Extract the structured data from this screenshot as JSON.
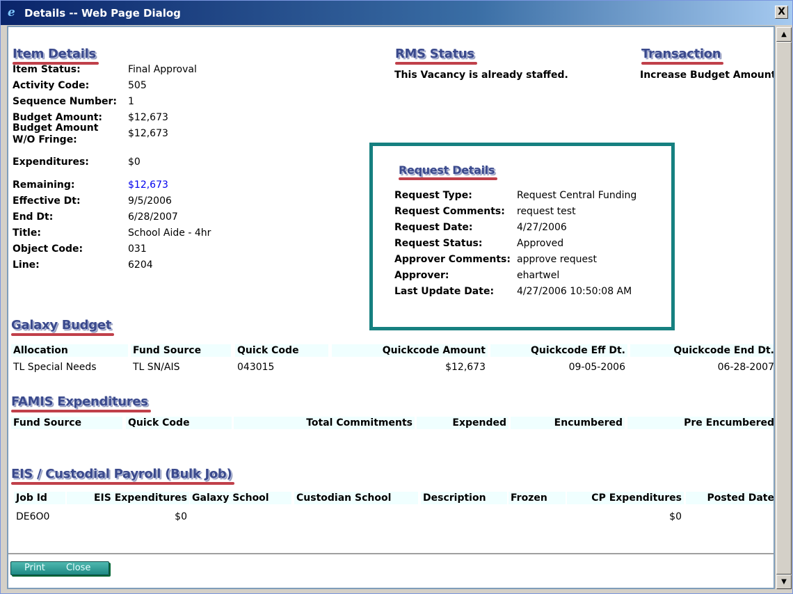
{
  "window": {
    "title": "Details -- Web Page Dialog",
    "close_glyph": "X",
    "icon": "ie-icon"
  },
  "item_details": {
    "heading": "Item Details",
    "rows": [
      {
        "label": "Item Status:",
        "value": "Final Approval"
      },
      {
        "label": "Activity Code:",
        "value": "505"
      },
      {
        "label": "Sequence Number:",
        "value": "1"
      },
      {
        "label": "Budget Amount:",
        "value": "$12,673"
      },
      {
        "label": "Budget Amount W/O Fringe:",
        "value": "$12,673"
      },
      {
        "label": "Expenditures:",
        "value": "$0"
      },
      {
        "label": "Remaining:",
        "value": "$12,673"
      },
      {
        "label": "Effective Dt:",
        "value": "9/5/2006"
      },
      {
        "label": "End Dt:",
        "value": "6/28/2007"
      },
      {
        "label": "Title:",
        "value": "School Aide - 4hr"
      },
      {
        "label": "Object Code:",
        "value": "031"
      },
      {
        "label": "Line:",
        "value": "6204"
      }
    ]
  },
  "rms_status": {
    "heading": "RMS Status",
    "text": "This Vacancy is already staffed."
  },
  "transaction": {
    "heading": "Transaction",
    "text": "Increase Budget Amount"
  },
  "request_details": {
    "heading": "Request Details",
    "rows": [
      {
        "label": "Request Type:",
        "value": "Request Central Funding"
      },
      {
        "label": "Request Comments:",
        "value": "request test"
      },
      {
        "label": "Request Date:",
        "value": "4/27/2006"
      },
      {
        "label": "Request Status:",
        "value": "Approved"
      },
      {
        "label": "Approver Comments:",
        "value": "approve request"
      },
      {
        "label": "Approver:",
        "value": "ehartwel"
      },
      {
        "label": "Last Update Date:",
        "value": "4/27/2006 10:50:08 AM"
      }
    ]
  },
  "galaxy_budget": {
    "heading": "Galaxy Budget",
    "headers": [
      "Allocation",
      "Fund Source",
      "Quick Code",
      "Quickcode Amount",
      "Quickcode Eff Dt.",
      "Quickcode End Dt."
    ],
    "rows": [
      [
        "TL Special Needs",
        "TL SN/AIS",
        "043015",
        "$12,673",
        "09-05-2006",
        "06-28-2007"
      ]
    ]
  },
  "famis": {
    "heading": "FAMIS Expenditures",
    "headers": [
      "Fund Source",
      "Quick Code",
      "Total Commitments",
      "Expended",
      "Encumbered",
      "Pre Encumbered"
    ]
  },
  "eis": {
    "heading": "EIS / Custodial Payroll (Bulk Job)",
    "headers": [
      "Job Id",
      "EIS Expenditures",
      "Galaxy School",
      "Custodian School",
      "Description",
      "Frozen",
      "CP Expenditures",
      "Posted Date"
    ],
    "rows": [
      [
        "DE6O0",
        "$0",
        "",
        "",
        "",
        "",
        "$0",
        ""
      ]
    ]
  },
  "buttons": {
    "print": "Print",
    "close": "Close"
  },
  "colors": {
    "heading": "#3b4a8c",
    "heading_underline": "#c0404a",
    "request_box_border": "#168080",
    "table_header_bg": "#f0ffff",
    "link_blue": "#0000ee"
  }
}
